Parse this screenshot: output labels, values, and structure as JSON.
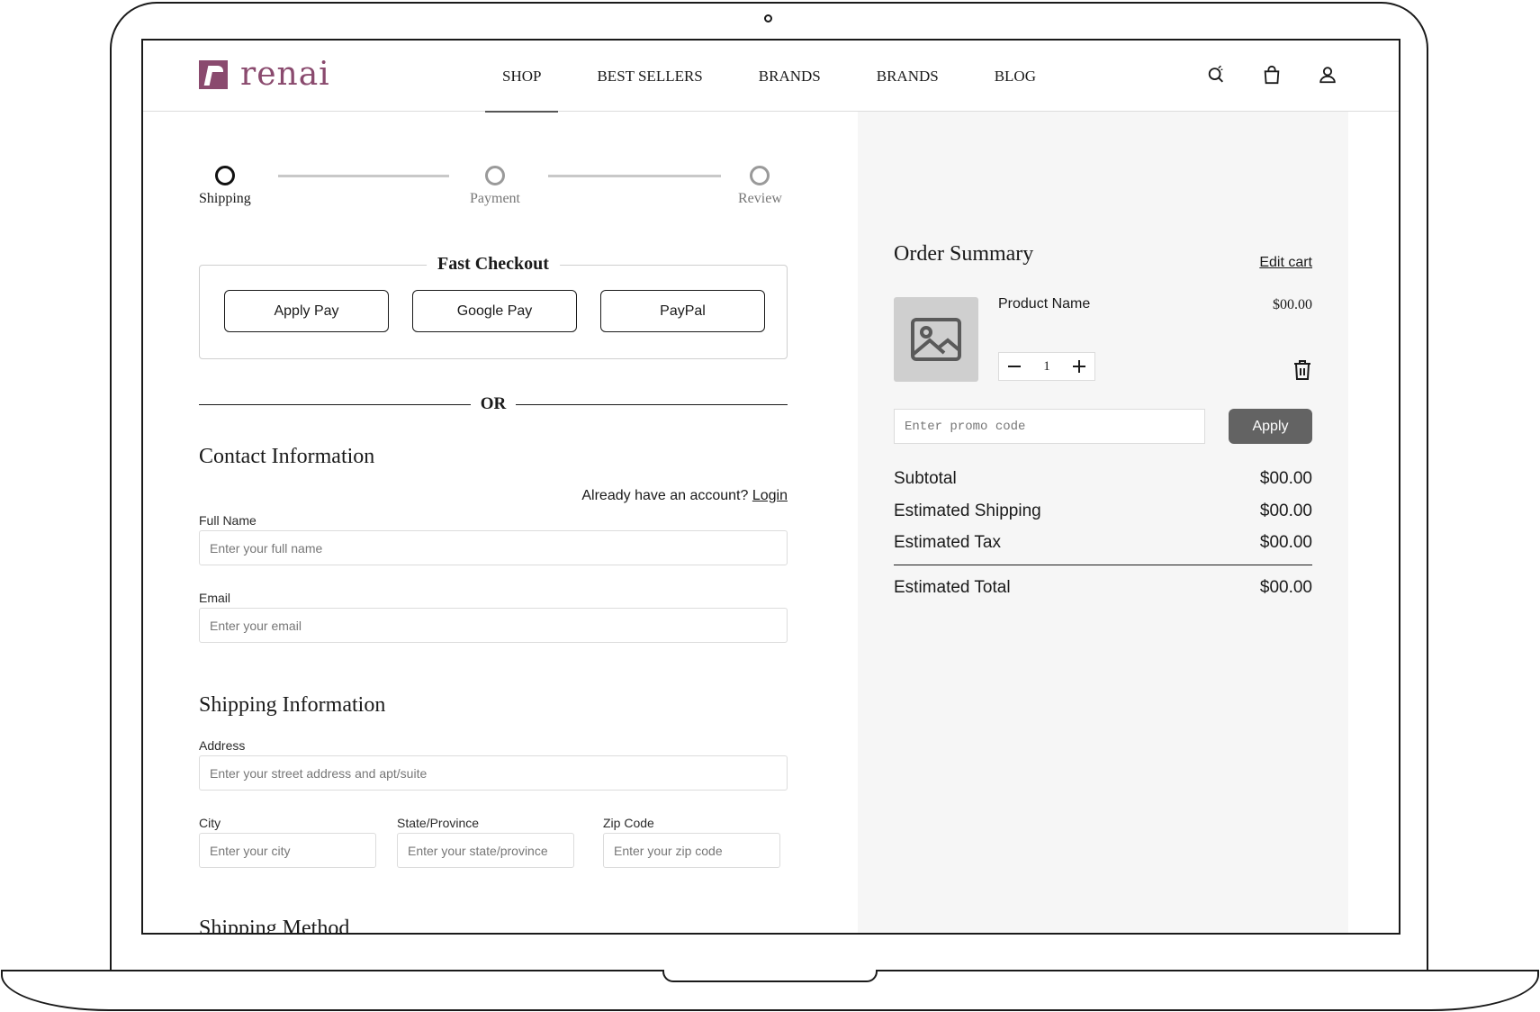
{
  "brand": {
    "name": "renai",
    "color": "#8a4a6e"
  },
  "nav": {
    "items": [
      {
        "label": "SHOP",
        "active": true
      },
      {
        "label": "BEST SELLERS"
      },
      {
        "label": "BRANDS"
      },
      {
        "label": "BRANDS"
      },
      {
        "label": "BLOG"
      }
    ]
  },
  "header_icons": [
    "search-icon",
    "shopping-bag-icon",
    "user-icon"
  ],
  "stepper": {
    "steps": [
      {
        "label": "Shipping",
        "active": true
      },
      {
        "label": "Payment"
      },
      {
        "label": "Review"
      }
    ]
  },
  "fast_checkout": {
    "title": "Fast Checkout",
    "buttons": [
      "Apply Pay",
      "Google Pay",
      "PayPal"
    ]
  },
  "or_label": "OR",
  "contact": {
    "title": "Contact Information",
    "account_prompt": "Already have an account?",
    "login_label": "Login",
    "full_name": {
      "label": "Full Name",
      "placeholder": "Enter your full name"
    },
    "email": {
      "label": "Email",
      "placeholder": "Enter your email"
    }
  },
  "shipping": {
    "title": "Shipping Information",
    "address": {
      "label": "Address",
      "placeholder": "Enter your street address and apt/suite"
    },
    "city": {
      "label": "City",
      "placeholder": "Enter your city"
    },
    "state": {
      "label": "State/Province",
      "placeholder": "Enter your state/province"
    },
    "zip": {
      "label": "Zip Code",
      "placeholder": "Enter your zip code"
    }
  },
  "shipping_method": {
    "title": "Shipping Method"
  },
  "order_summary": {
    "title": "Order Summary",
    "edit_cart": "Edit cart",
    "product": {
      "name": "Product Name",
      "price": "$00.00",
      "quantity": "1"
    },
    "promo": {
      "placeholder": "Enter promo code",
      "apply_label": "Apply"
    },
    "subtotal": {
      "label": "Subtotal",
      "value": "$00.00"
    },
    "shipping": {
      "label": "Estimated Shipping",
      "value": "$00.00"
    },
    "tax": {
      "label": "Estimated Tax",
      "value": "$00.00"
    },
    "total": {
      "label": "Estimated Total",
      "value": "$00.00"
    }
  }
}
